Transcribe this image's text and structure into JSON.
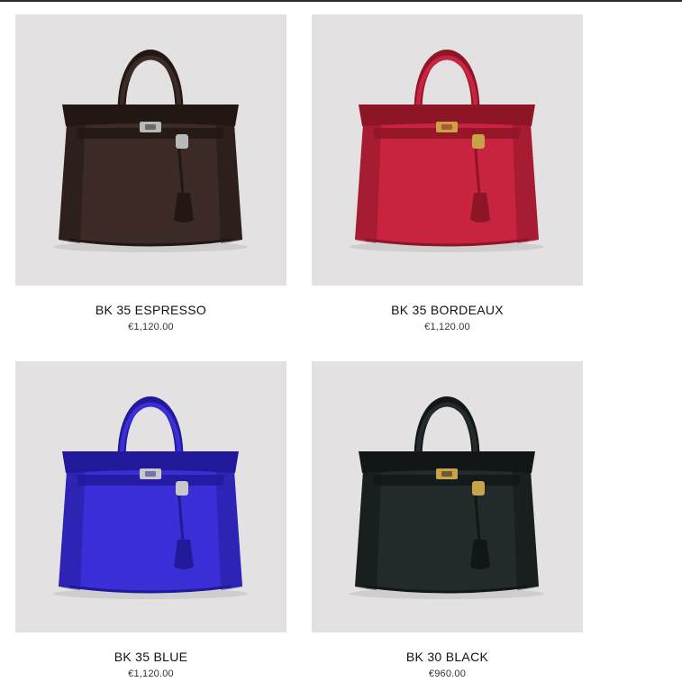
{
  "products": [
    {
      "name": "BK 35 ESPRESSO",
      "price": "€1,120.00",
      "bag_color": "#3b2a26",
      "bag_shade": "#231714",
      "hardware_color": "#b9b9b9",
      "image_icon": "handbag-icon"
    },
    {
      "name": "BK 35 BORDEAUX",
      "price": "€1,120.00",
      "bag_color": "#c8243f",
      "bag_shade": "#8e1526",
      "hardware_color": "#c9a245",
      "image_icon": "handbag-icon"
    },
    {
      "name": "BK 35 BLUE",
      "price": "€1,120.00",
      "bag_color": "#3a2fd6",
      "bag_shade": "#22199a",
      "hardware_color": "#c8c8c8",
      "image_icon": "handbag-icon"
    },
    {
      "name": "BK 30 BLACK",
      "price": "€960.00",
      "bag_color": "#232a2c",
      "bag_shade": "#121617",
      "hardware_color": "#caa24a",
      "image_icon": "handbag-icon"
    }
  ]
}
